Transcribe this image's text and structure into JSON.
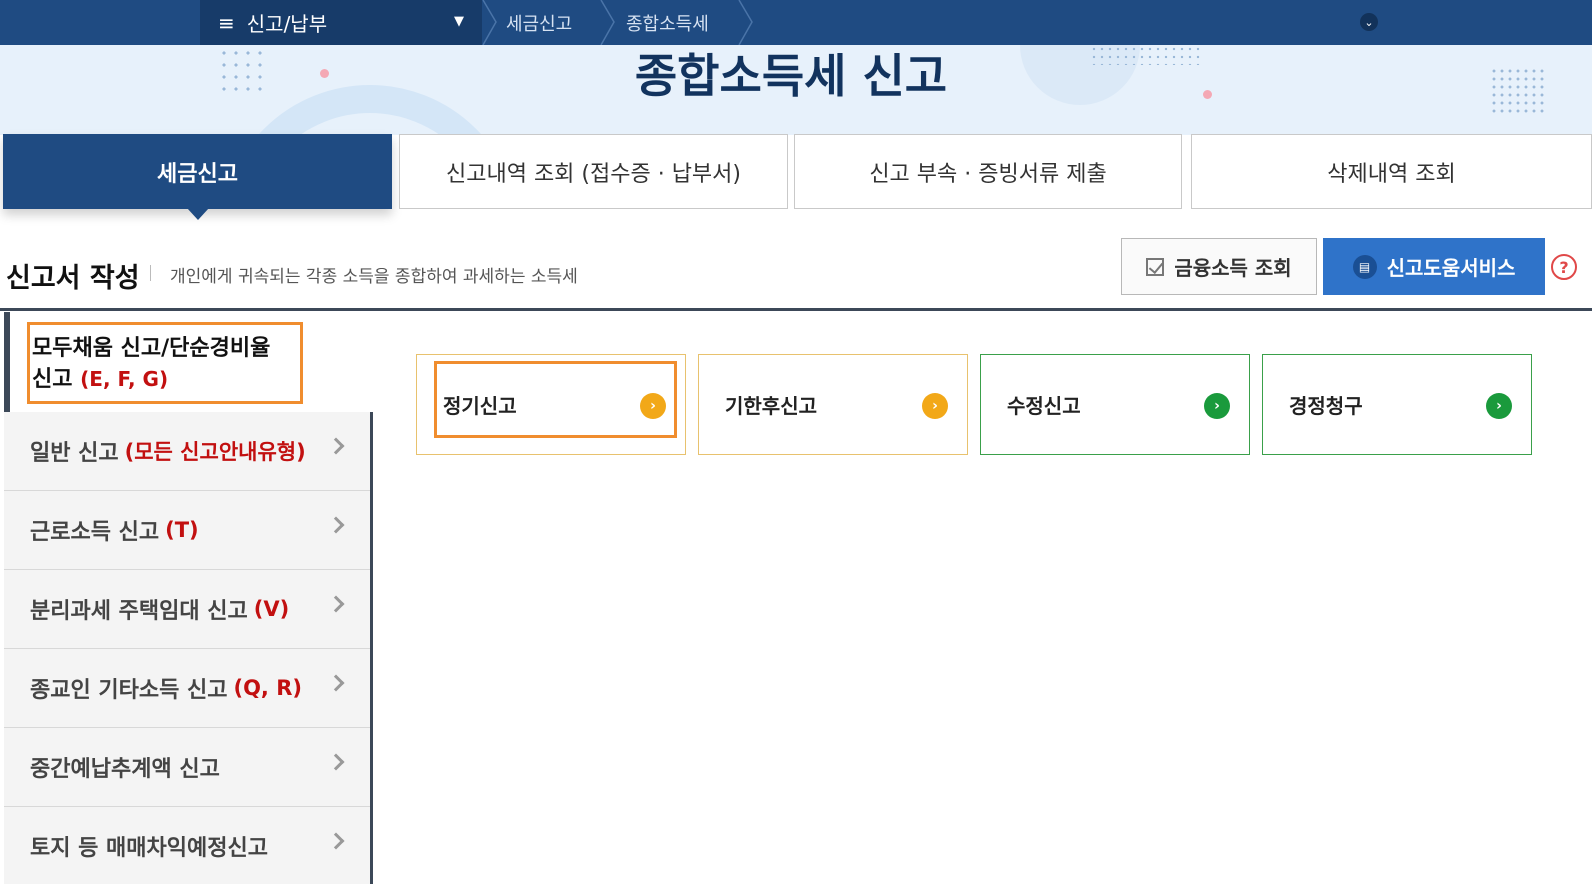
{
  "topnav": {
    "menu_label": "신고/납부",
    "breadcrumbs": [
      "세금신고",
      "종합소득세"
    ],
    "colors": {
      "bar": "#1f4b82",
      "menu": "#173b69"
    }
  },
  "hero": {
    "title": "종합소득세 신고"
  },
  "tabs": [
    {
      "label": "세금신고",
      "active": true
    },
    {
      "label": "신고내역 조회 (접수증 · 납부서)",
      "active": false
    },
    {
      "label": "신고 부속 · 증빙서류 제출",
      "active": false
    },
    {
      "label": "삭제내역 조회",
      "active": false
    }
  ],
  "section": {
    "title": "신고서 작성",
    "description": "개인에게 귀속되는 각종 소득을 종합하여 과세하는 소득세",
    "financial_button": "금융소득 조회",
    "help_button": "신고도움서비스",
    "help_icon": "?"
  },
  "sidebar": {
    "selected": {
      "line1": "모두채움 신고/단순경비율",
      "line2": "신고",
      "code": "(E, F, G)"
    },
    "items": [
      {
        "label": "일반 신고",
        "code": "(모든 신고안내유형)"
      },
      {
        "label": "근로소득 신고",
        "code": "(T)"
      },
      {
        "label": "분리과세 주택임대 신고",
        "code": "(V)"
      },
      {
        "label": "종교인 기타소득 신고",
        "code": "(Q, R)"
      },
      {
        "label": "중간예납추계액 신고",
        "code": ""
      },
      {
        "label": "토지 등 매매차익예정신고",
        "code": ""
      }
    ]
  },
  "cards": [
    {
      "label": "정기신고",
      "style": "orange",
      "highlighted": true
    },
    {
      "label": "기한후신고",
      "style": "orange",
      "highlighted": false
    },
    {
      "label": "수정신고",
      "style": "green",
      "highlighted": false
    },
    {
      "label": "경정청구",
      "style": "green",
      "highlighted": false
    }
  ],
  "colors": {
    "accent": "#2f73c9",
    "highlight": "#f08d2e",
    "code_red": "#c21010",
    "card_orange": "#f2a818",
    "card_green": "#1a9a3c"
  }
}
